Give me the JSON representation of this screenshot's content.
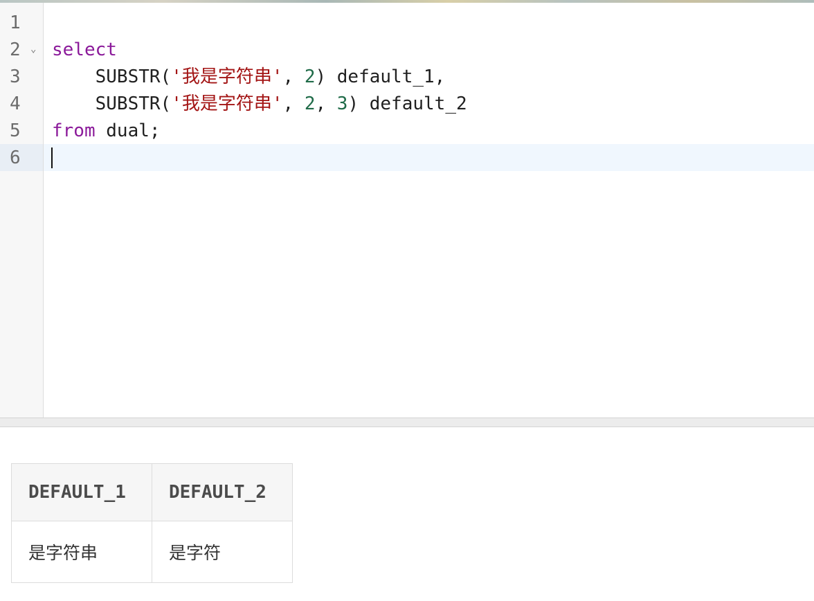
{
  "editor": {
    "lines": [
      {
        "num": "1",
        "tokens": []
      },
      {
        "num": "2",
        "tokens": [
          {
            "t": "select",
            "c": "kw"
          }
        ]
      },
      {
        "num": "3",
        "tokens": [
          {
            "t": "    SUBSTR(",
            "c": ""
          },
          {
            "t": "'我是字符串'",
            "c": "str"
          },
          {
            "t": ", ",
            "c": ""
          },
          {
            "t": "2",
            "c": "num"
          },
          {
            "t": ") default_1,",
            "c": ""
          }
        ]
      },
      {
        "num": "4",
        "tokens": [
          {
            "t": "    SUBSTR(",
            "c": ""
          },
          {
            "t": "'我是字符串'",
            "c": "str"
          },
          {
            "t": ", ",
            "c": ""
          },
          {
            "t": "2",
            "c": "num"
          },
          {
            "t": ", ",
            "c": ""
          },
          {
            "t": "3",
            "c": "num"
          },
          {
            "t": ") default_2",
            "c": ""
          }
        ]
      },
      {
        "num": "5",
        "tokens": [
          {
            "t": "from",
            "c": "kw"
          },
          {
            "t": " dual;",
            "c": ""
          }
        ]
      },
      {
        "num": "6",
        "tokens": []
      }
    ],
    "active_line": "6",
    "fold_icon": "chevron-down-icon"
  },
  "results": {
    "columns": [
      "DEFAULT_1",
      "DEFAULT_2"
    ],
    "rows": [
      [
        "是字符串",
        "是字符"
      ]
    ]
  },
  "colors": {
    "keyword": "#8b1a9a",
    "string": "#a31515",
    "number": "#1f6b48",
    "active_line_bg": "#f0f7fe"
  }
}
